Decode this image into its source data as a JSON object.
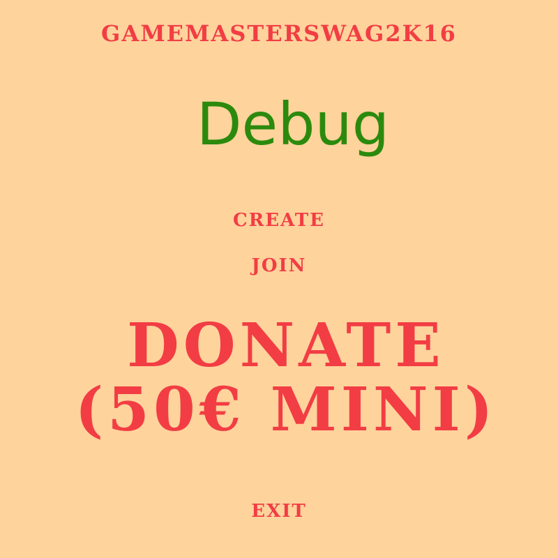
{
  "header": {
    "username": "GAMEMASTERSWAG2K16",
    "mode_label": "Debug"
  },
  "menu": {
    "create_label": "CREATE",
    "join_label": "JOIN",
    "donate_label": "DONATE (50€ MINI)",
    "exit_label": "EXIT"
  },
  "colors": {
    "background": "#fed39c",
    "menu_text": "#f23d44",
    "debug_text": "#2b8a0d"
  }
}
